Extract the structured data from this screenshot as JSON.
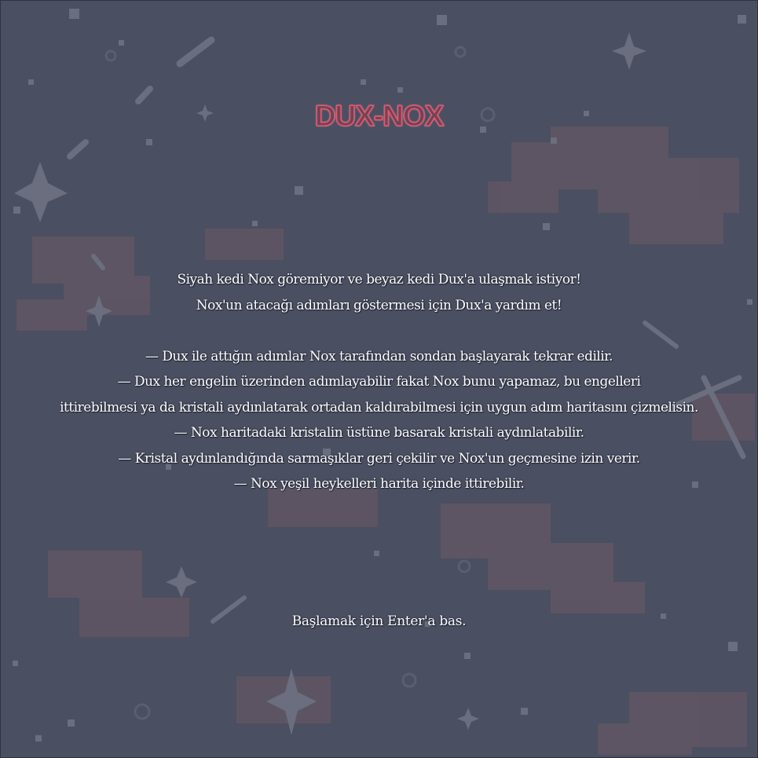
{
  "game": {
    "title": "DUX-NOX",
    "intro_lines": [
      "Siyah kedi Nox göremiyor ve beyaz kedi Dux'a ulaşmak istiyor!",
      "Nox'un atacağı adımları göstermesi için Dux'a yardım et!"
    ],
    "rules": [
      "— Dux ile attığın adımlar Nox tarafından sondan başlayarak tekrar edilir.",
      "— Dux her engelin üzerinden adımlayabilir fakat Nox bunu yapamaz, bu engelleri",
      "ittirebilmesi ya da kristali aydınlatarak ortadan kaldırabilmesi için uygun adım haritasını çizmelisin.",
      "— Nox haritadaki kristalin üstüne basarak kristali aydınlatabilir.",
      "— Kristal aydınlandığında sarmaşıklar geri çekilir ve Nox'un geçmesine izin verir.",
      "— Nox yeşil heykelleri harita içinde ittirebilir."
    ],
    "start_prompt": "Başlamak için Enter'a bas."
  },
  "colors": {
    "background": "#4a4f61",
    "title_outline": "#f04f6b",
    "title_fill": "#6b4654",
    "text": "#ffffff",
    "nebula": "#6e5a66",
    "stars": "#6a6e7e"
  },
  "icons": {
    "background": "starfield-pattern"
  }
}
